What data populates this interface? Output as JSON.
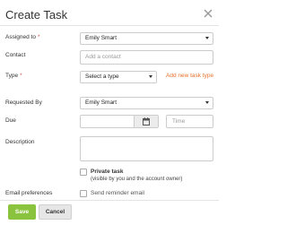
{
  "dialog": {
    "title": "Create Task",
    "close_icon": "close-icon"
  },
  "fields": {
    "assigned_to": {
      "label": "Assigned to",
      "required": "*",
      "value": "Emily Smart"
    },
    "contact": {
      "label": "Contact",
      "placeholder": "Add a contact"
    },
    "type": {
      "label": "Type",
      "required": "*",
      "value": "Select a type",
      "add_link": "Add new task type"
    },
    "requested_by": {
      "label": "Requested By",
      "value": "Emily Smart"
    },
    "due": {
      "label": "Due",
      "calendar_icon": "calendar-icon",
      "time_placeholder": "Time"
    },
    "description": {
      "label": "Description"
    },
    "private_task": {
      "label": "Private task",
      "sublabel": "(visible by you and the account owner)",
      "checked": false
    },
    "email_preferences": {
      "label": "Email preferences",
      "option": "Send reminder email",
      "checked": false
    }
  },
  "footer": {
    "save_label": "Save",
    "cancel_label": "Cancel"
  },
  "colors": {
    "accent_link": "#e8702a",
    "save_button": "#8ac43f",
    "required_marker": "#d9534f"
  }
}
